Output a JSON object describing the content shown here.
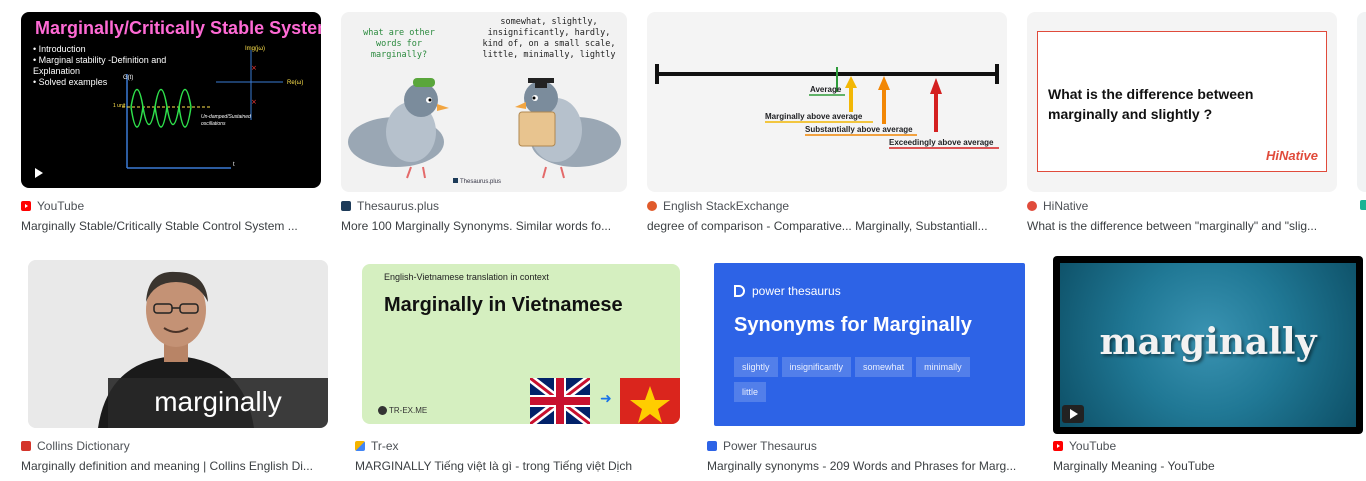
{
  "cards": [
    {
      "source": "YouTube",
      "caption": "Marginally Stable/Critically Stable Control System ...",
      "image": {
        "title": "Marginally/Critically Stable System",
        "bullets": [
          "Introduction",
          "Marginal stability -Definition and Explanation",
          "Solved examples"
        ],
        "labels": {
          "img": "Img(jω)",
          "re": "Re(ω)",
          "gt": "G(t)",
          "unit": "1 unit",
          "osc": "Un-damped/Sustained oscillations",
          "t": "t"
        }
      }
    },
    {
      "source": "Thesaurus.plus",
      "caption": "More 100 Marginally Synonyms. Similar words fo...",
      "image": {
        "left_bubble": "what are other words for marginally?",
        "right_bubble": "somewhat, slightly, insignificantly, hardly, kind of, on a small scale, little, minimally, lightly",
        "watermark": "Thesaurus.plus"
      }
    },
    {
      "source": "English StackExchange",
      "caption": "degree of comparison - Comparative... Marginally, Substantiall...",
      "image": {
        "labels": [
          "Average",
          "Marginally above average",
          "Substantially above average",
          "Exceedingly above average"
        ]
      }
    },
    {
      "source": "HiNative",
      "caption": "What is the difference between \"marginally\" and \"slig...",
      "image": {
        "question": "What is the difference between marginally and slightly ?",
        "logo": "HiNative"
      }
    },
    {
      "source": "Collins Dictionary",
      "caption": "Marginally definition and meaning | Collins English Di...",
      "image": {
        "word": "marginally"
      }
    },
    {
      "source": "Tr-ex",
      "caption": "MARGINALLY Tiếng việt là gì - trong Tiếng việt Dịch",
      "image": {
        "subtitle": "English-Vietnamese translation in context",
        "title": "Marginally in Vietnamese",
        "logo": "TR-EX.ME"
      }
    },
    {
      "source": "Power Thesaurus",
      "caption": "Marginally synonyms - 209 Words and Phrases for Marg...",
      "image": {
        "brand": "power thesaurus",
        "title": "Synonyms for Marginally",
        "chips": [
          "slightly",
          "insignificantly",
          "somewhat",
          "minimally",
          "little"
        ]
      }
    },
    {
      "source": "YouTube",
      "caption": "Marginally Meaning - YouTube",
      "image": {
        "word": "marginally"
      }
    }
  ],
  "colors": {
    "youtube": "#ff0000",
    "collins": "#d4342a",
    "power_thesaurus": "#2d63e6",
    "hinative": "#e04b3b"
  },
  "icons": [
    "youtube-icon",
    "thesaurus-plus-icon",
    "stackexchange-icon",
    "hinative-icon",
    "collins-icon",
    "tr-ex-icon",
    "power-thesaurus-icon",
    "play-icon",
    "arrow-right-icon"
  ]
}
